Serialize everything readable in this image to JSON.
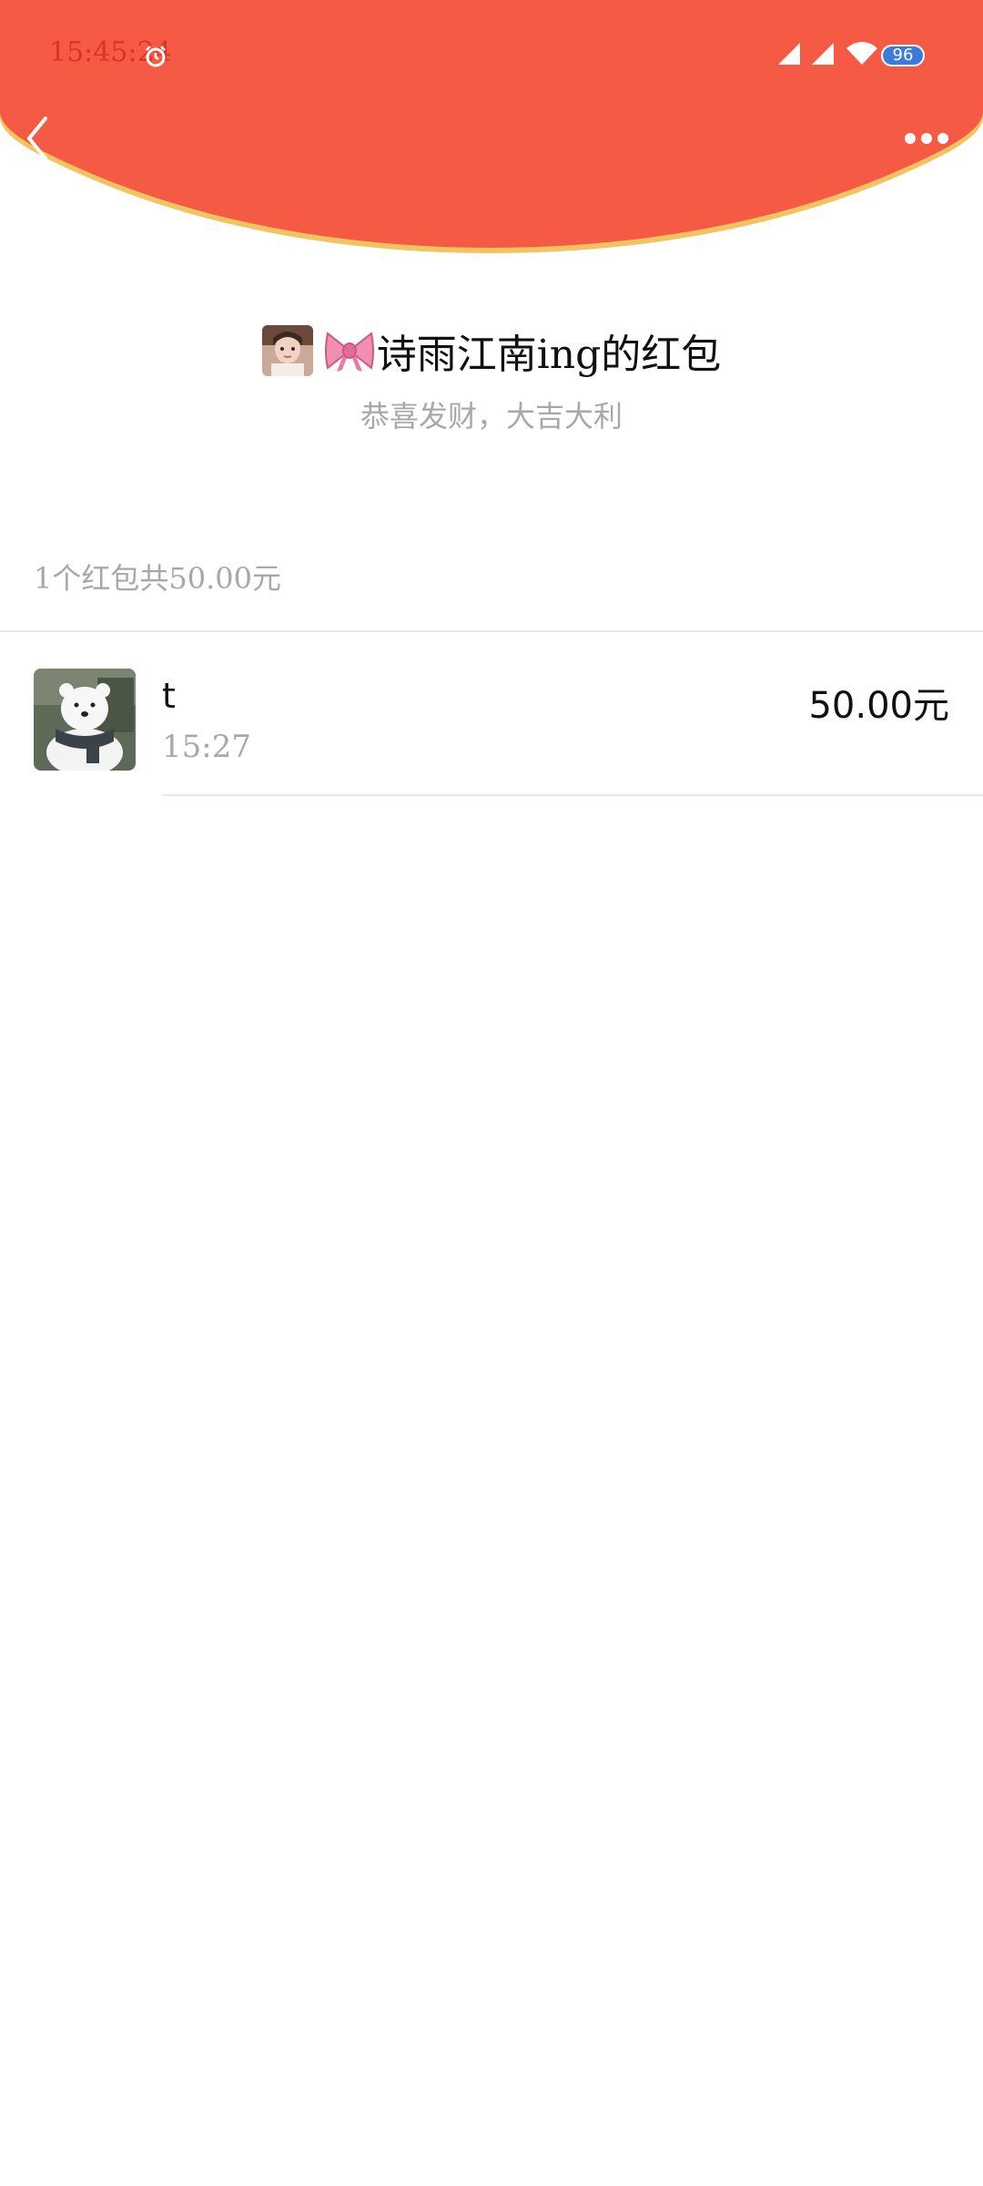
{
  "status_bar": {
    "time": "15:45:24",
    "battery": "96"
  },
  "sender": {
    "title": "诗雨江南ing的红包",
    "greeting": "恭喜发财，大吉大利"
  },
  "summary": "1个红包共50.00元",
  "records": [
    {
      "name": "t",
      "time": "15:27",
      "amount": "50.00元"
    }
  ],
  "colors": {
    "header_red": "#f55a45",
    "header_rim": "#f2c461"
  },
  "icons": {
    "back": "chevron-left-icon",
    "more": "more-dots-icon",
    "alarm": "alarm-icon",
    "signal": "signal-icon",
    "wifi": "wifi-icon",
    "bow": "bow-icon"
  }
}
